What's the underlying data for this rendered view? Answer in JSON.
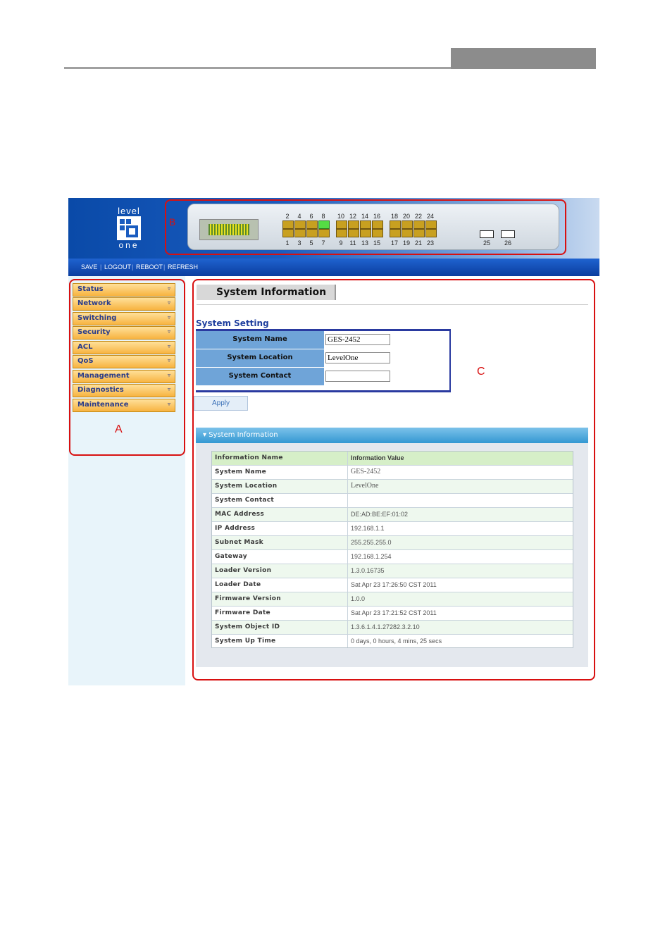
{
  "brand": {
    "logo_top": "level",
    "logo_bottom": "one"
  },
  "ports": {
    "top_labels": [
      "2",
      "4",
      "6",
      "8",
      "10",
      "12",
      "14",
      "16",
      "18",
      "20",
      "22",
      "24"
    ],
    "bottom_labels": [
      "1",
      "3",
      "5",
      "7",
      "9",
      "11",
      "13",
      "15",
      "17",
      "19",
      "21",
      "23"
    ],
    "active_port": "8",
    "sfp_labels": [
      "25",
      "26"
    ]
  },
  "toolbar": {
    "save": "SAVE",
    "logout": "LOGOUT",
    "reboot": "REBOOT",
    "refresh": "REFRESH",
    "separator": "|"
  },
  "sidebar": {
    "items": [
      "Status",
      "Network",
      "Switching",
      "Security",
      "ACL",
      "QoS",
      "Management",
      "Diagnostics",
      "Maintenance"
    ],
    "arrow": "▿"
  },
  "page_title": "System Information",
  "setting": {
    "heading": "System Setting",
    "fields": [
      {
        "label": "System Name",
        "value": "GES-2452"
      },
      {
        "label": "System Location",
        "value": "LevelOne"
      },
      {
        "label": "System Contact",
        "value": ""
      }
    ],
    "apply_label": "Apply"
  },
  "info": {
    "bar_title": "▾ System Information",
    "headers": [
      "Information Name",
      "Information Value"
    ],
    "rows": [
      [
        "System Name",
        "GES-2452"
      ],
      [
        "System Location",
        "LevelOne"
      ],
      [
        "System Contact",
        ""
      ],
      [
        "MAC Address",
        "DE:AD:BE:EF:01:02"
      ],
      [
        "IP Address",
        "192.168.1.1"
      ],
      [
        "Subnet Mask",
        "255.255.255.0"
      ],
      [
        "Gateway",
        "192.168.1.254"
      ],
      [
        "Loader Version",
        "1.3.0.16735"
      ],
      [
        "Loader Date",
        "Sat Apr 23 17:26:50 CST 2011"
      ],
      [
        "Firmware Version",
        "1.0.0"
      ],
      [
        "Firmware Date",
        "Sat Apr 23 17:21:52 CST 2011"
      ],
      [
        "System Object ID",
        "1.3.6.1.4.1.27282.3.2.10"
      ],
      [
        "System Up Time",
        "0 days, 0 hours, 4 mins, 25 secs"
      ]
    ]
  },
  "annotations": {
    "a": "A",
    "b": "B",
    "c": "C"
  },
  "colors": {
    "annotation": "#d81010",
    "menubar": "#0b3d9e",
    "nav_item": "#f7b340",
    "port_up": "#55dd44"
  }
}
